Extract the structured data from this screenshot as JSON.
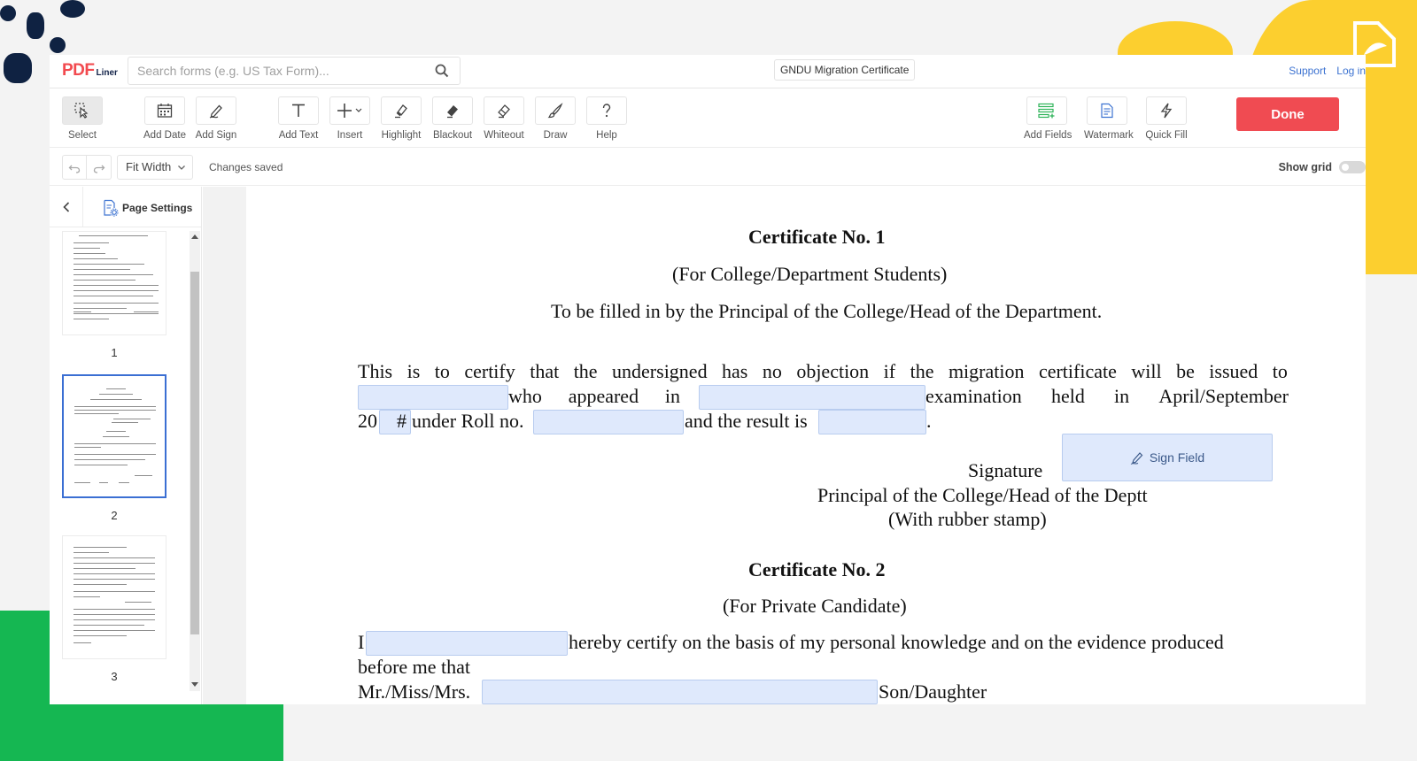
{
  "logo": {
    "brand": "PDF",
    "suffix": "Liner"
  },
  "search": {
    "placeholder": "Search forms (e.g. US Tax Form)..."
  },
  "document_title": "GNDU Migration Certificate",
  "top_links": {
    "support": "Support",
    "login": "Log in"
  },
  "toolbar": {
    "tools": [
      {
        "label": "Select",
        "icon": "select-cursor-icon"
      },
      {
        "label": "Add Date",
        "icon": "calendar-icon"
      },
      {
        "label": "Add Sign",
        "icon": "pen-icon"
      },
      {
        "label": "Add Text",
        "icon": "text-icon"
      },
      {
        "label": "Insert",
        "icon": "plus-icon"
      },
      {
        "label": "Highlight",
        "icon": "highlighter-icon"
      },
      {
        "label": "Blackout",
        "icon": "eraser-icon"
      },
      {
        "label": "Whiteout",
        "icon": "whiteout-icon"
      },
      {
        "label": "Draw",
        "icon": "brush-icon"
      },
      {
        "label": "Help",
        "icon": "question-icon"
      },
      {
        "label": "Add Fields",
        "icon": "fields-icon"
      },
      {
        "label": "Watermark",
        "icon": "watermark-icon"
      },
      {
        "label": "Quick Fill",
        "icon": "lightning-icon"
      }
    ],
    "done_label": "Done"
  },
  "subbar": {
    "zoom": "Fit Width",
    "status": "Changes saved",
    "show_grid_label": "Show grid",
    "show_grid_on": false
  },
  "sidebar": {
    "page_settings_label": "Page Settings",
    "pages": [
      "1",
      "2",
      "3"
    ],
    "selected_page": "2"
  },
  "document": {
    "cert1_title": "Certificate No. 1",
    "cert1_subtitle": "(For College/Department Students)",
    "cert1_instruction": "To be filled in by the Principal of the College/Head of the Department.",
    "para1_line1_words": [
      "This",
      "is",
      "to",
      "certify",
      "that",
      "the",
      "undersigned",
      "has",
      "no",
      "objection",
      "if",
      "the",
      "migration",
      "certificate",
      "will",
      "be",
      "issued",
      "to"
    ],
    "para1_line2_words_a": [
      "who",
      "appeared",
      "in"
    ],
    "para1_line2_words_b": [
      "examination",
      "held",
      "in",
      "April/September"
    ],
    "year_prefix": "20",
    "year_field_hash": "#",
    "roll_text": "under Roll no.",
    "result_text": "and the result is",
    "period": ".",
    "sign_field_label": "Sign Field",
    "signature_label": "Signature",
    "principal_line": "Principal of the College/Head of the Deptt",
    "stamp_line": "(With rubber stamp)",
    "cert2_title": "Certificate No. 2",
    "cert2_subtitle": "(For Private Candidate)",
    "cert2_i": "I",
    "cert2_line1_rest": "hereby certify on the basis of my personal knowledge and on the evidence produced",
    "cert2_line2": "before me that",
    "cert2_line3_partial": "Mr./Miss/Mrs.",
    "cert2_line3_end_partial": "Son/Daughter"
  },
  "colors": {
    "accent_red": "#f04b52",
    "link_blue": "#3d73d1",
    "field_fill": "#dfe9fc",
    "decor_yellow": "#fccf2f",
    "decor_green": "#15b752",
    "decor_navy": "#0f2242"
  }
}
